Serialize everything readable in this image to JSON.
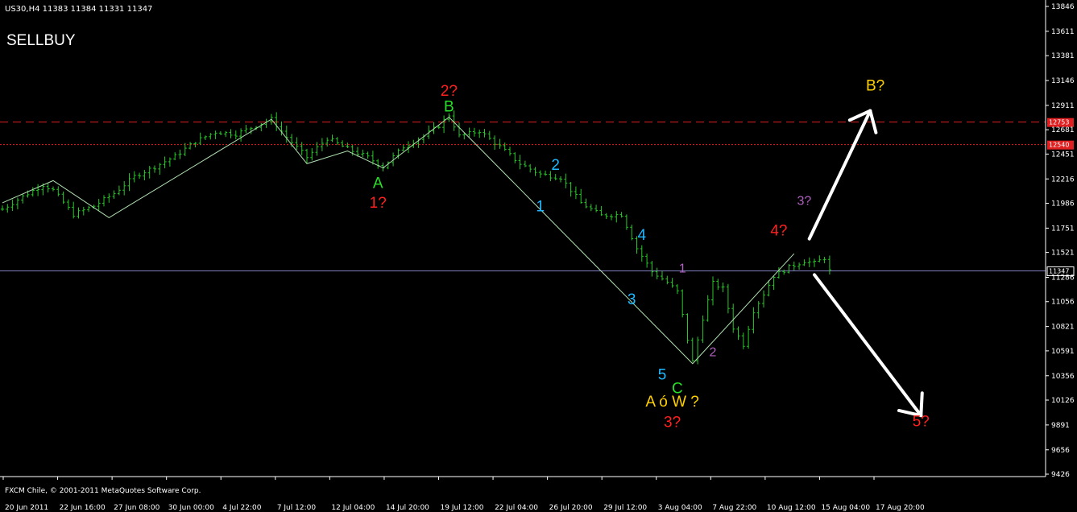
{
  "header": {
    "symbol_line": "US30,H4  11383 11384 11331 11347",
    "watermark": "SELLBUY",
    "copyright": "FXCM Chile, © 2001-2011 MetaQuotes Software Corp."
  },
  "colors": {
    "background": "#000000",
    "bars": "#28c828",
    "axis": "#ffffff",
    "level_red": "#e02020",
    "current_line": "#8080c0",
    "arrow": "#ffffff",
    "wave_line": "#b0e0b0"
  },
  "chart_data": {
    "type": "ohlc",
    "symbol": "US30",
    "timeframe": "H4",
    "ohlc_header": {
      "open": 11383,
      "high": 11384,
      "low": 11331,
      "close": 11347
    },
    "ylim": [
      9426,
      13846
    ],
    "y_ticks": [
      13846,
      13611,
      13381,
      13146,
      12911,
      12681,
      12451,
      12216,
      11986,
      11751,
      11521,
      11286,
      11056,
      10821,
      10591,
      10356,
      10126,
      9891,
      9656,
      9426
    ],
    "x_ticks": [
      "20 Jun 2011",
      "22 Jun 16:00",
      "27 Jun 08:00",
      "30 Jun 00:00",
      "4 Jul 22:00",
      "7 Jul 12:00",
      "12 Jul 04:00",
      "14 Jul 20:00",
      "19 Jul 12:00",
      "22 Jul 04:00",
      "26 Jul 20:00",
      "29 Jul 12:00",
      "3 Aug 04:00",
      "7 Aug 22:00",
      "10 Aug 12:00",
      "15 Aug 04:00",
      "17 Aug 20:00"
    ],
    "price_path": [
      [
        0,
        11930
      ],
      [
        4,
        12050
      ],
      [
        8,
        12160
      ],
      [
        10,
        12110
      ],
      [
        14,
        11880
      ],
      [
        18,
        11960
      ],
      [
        22,
        12080
      ],
      [
        26,
        12240
      ],
      [
        30,
        12330
      ],
      [
        34,
        12430
      ],
      [
        38,
        12570
      ],
      [
        42,
        12660
      ],
      [
        46,
        12640
      ],
      [
        50,
        12720
      ],
      [
        53,
        12780
      ],
      [
        56,
        12610
      ],
      [
        60,
        12420
      ],
      [
        64,
        12600
      ],
      [
        68,
        12500
      ],
      [
        72,
        12420
      ],
      [
        75,
        12330
      ],
      [
        79,
        12520
      ],
      [
        83,
        12620
      ],
      [
        86,
        12720
      ],
      [
        88,
        12820
      ],
      [
        90,
        12620
      ],
      [
        94,
        12670
      ],
      [
        98,
        12520
      ],
      [
        102,
        12360
      ],
      [
        106,
        12260
      ],
      [
        110,
        12230
      ],
      [
        114,
        11990
      ],
      [
        118,
        11870
      ],
      [
        122,
        11880
      ],
      [
        125,
        11560
      ],
      [
        128,
        11340
      ],
      [
        131,
        11240
      ],
      [
        133,
        11150
      ],
      [
        135,
        10700
      ],
      [
        136,
        10490
      ],
      [
        138,
        10900
      ],
      [
        140,
        11230
      ],
      [
        142,
        11180
      ],
      [
        144,
        10810
      ],
      [
        146,
        10650
      ],
      [
        148,
        10970
      ],
      [
        150,
        11130
      ],
      [
        152,
        11300
      ],
      [
        155,
        11380
      ],
      [
        158,
        11440
      ],
      [
        160,
        11420
      ],
      [
        162,
        11470
      ],
      [
        163,
        11347
      ]
    ],
    "bar_count": 164,
    "levels": [
      {
        "value": 12753,
        "style": "dashed",
        "color": "#e02020"
      },
      {
        "value": 12540,
        "style": "dotted",
        "color": "#e02020"
      },
      {
        "value": 11347,
        "style": "solid",
        "color": "#8080c0"
      }
    ],
    "level_labels": [
      "12753",
      "12540",
      "11347"
    ],
    "wave_lines": [
      [
        [
          0,
          11990
        ],
        [
          10,
          12200
        ],
        [
          21,
          11850
        ],
        [
          53,
          12780
        ],
        [
          60,
          12360
        ],
        [
          68,
          12480
        ],
        [
          75,
          12320
        ],
        [
          88,
          12800
        ],
        [
          136,
          10470
        ],
        [
          156,
          11510
        ]
      ]
    ],
    "annotations": [
      {
        "text": "2?",
        "color": "#ff2020",
        "x": 88,
        "y": 13000,
        "size": "lg"
      },
      {
        "text": "B",
        "color": "#28e028",
        "x": 88,
        "y": 12855,
        "size": "lg"
      },
      {
        "text": "A",
        "color": "#28e028",
        "x": 74,
        "y": 12130,
        "size": "lg"
      },
      {
        "text": "1?",
        "color": "#ff2020",
        "x": 74,
        "y": 11945,
        "size": "lg"
      },
      {
        "text": "2",
        "color": "#20b8ff",
        "x": 109,
        "y": 12300,
        "size": "lg"
      },
      {
        "text": "1",
        "color": "#20b8ff",
        "x": 106,
        "y": 11910,
        "size": "lg"
      },
      {
        "text": "4",
        "color": "#20b8ff",
        "x": 126,
        "y": 11640,
        "size": "lg"
      },
      {
        "text": "3",
        "color": "#20b8ff",
        "x": 124,
        "y": 11030,
        "size": "lg"
      },
      {
        "text": "5",
        "color": "#20b8ff",
        "x": 130,
        "y": 10320,
        "size": "lg"
      },
      {
        "text": "C",
        "color": "#28e028",
        "x": 133,
        "y": 10190,
        "size": "lg"
      },
      {
        "text": "A ó W ?",
        "color": "#ffd000",
        "x": 132,
        "y": 10065,
        "size": "lg"
      },
      {
        "text": "3?",
        "color": "#ff2020",
        "x": 132,
        "y": 9870,
        "size": "lg"
      },
      {
        "text": "1",
        "color": "#b060c0",
        "x": 134,
        "y": 11330,
        "size": "sm"
      },
      {
        "text": "2",
        "color": "#b060c0",
        "x": 140,
        "y": 10540,
        "size": "sm"
      },
      {
        "text": "3?",
        "color": "#b060c0",
        "x": 158,
        "y": 11970,
        "size": "sm"
      },
      {
        "text": "4?",
        "color": "#ff2020",
        "x": 153,
        "y": 11680,
        "size": "lg"
      },
      {
        "text": "B?",
        "color": "#ffd000",
        "x": 172,
        "y": 13050,
        "size": "lg"
      },
      {
        "text": "5?",
        "color": "#ff2020",
        "x": 181,
        "y": 9880,
        "size": "lg"
      }
    ],
    "arrows": [
      {
        "from": [
          159,
          11650
        ],
        "to": [
          171,
          12860
        ]
      },
      {
        "from": [
          160,
          11310
        ],
        "to": [
          181,
          9980
        ]
      }
    ]
  }
}
